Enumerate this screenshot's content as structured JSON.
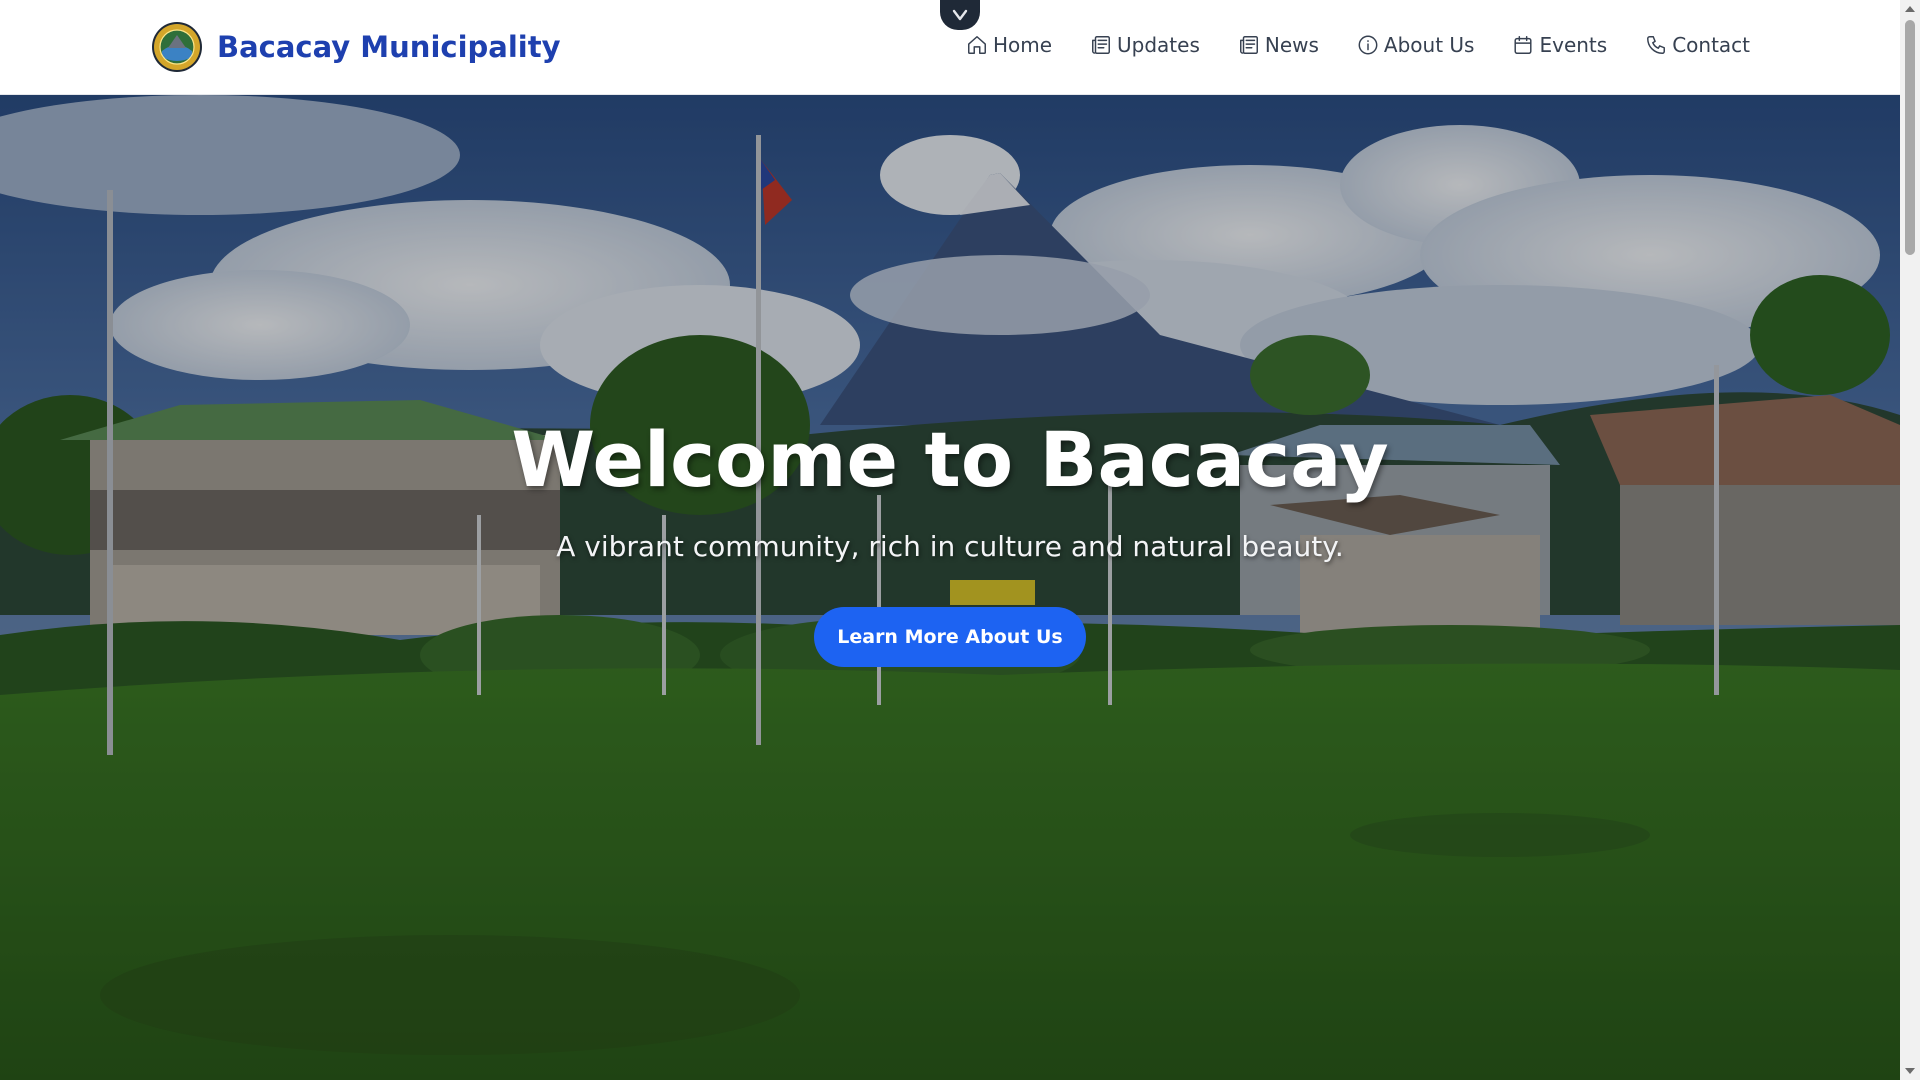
{
  "header": {
    "brand_name": "Bacacay Municipality",
    "brand_color": "#1e40af",
    "logo_icon": "municipal-seal-icon",
    "nav": [
      {
        "label": "Home",
        "icon": "home-icon"
      },
      {
        "label": "Updates",
        "icon": "newspaper-icon"
      },
      {
        "label": "News",
        "icon": "newspaper-icon"
      },
      {
        "label": "About Us",
        "icon": "info-circle-icon"
      },
      {
        "label": "Events",
        "icon": "calendar-icon"
      },
      {
        "label": "Contact",
        "icon": "phone-icon"
      }
    ]
  },
  "top_toggle": {
    "icon": "chevron-down-icon"
  },
  "hero": {
    "title": "Welcome to Bacacay",
    "subtitle": "A vibrant community, rich in culture and natural beauty.",
    "cta_label": "Learn More About Us",
    "cta_color": "#1d63f2",
    "background_description_icon": "town-plaza-volcano-photo"
  }
}
